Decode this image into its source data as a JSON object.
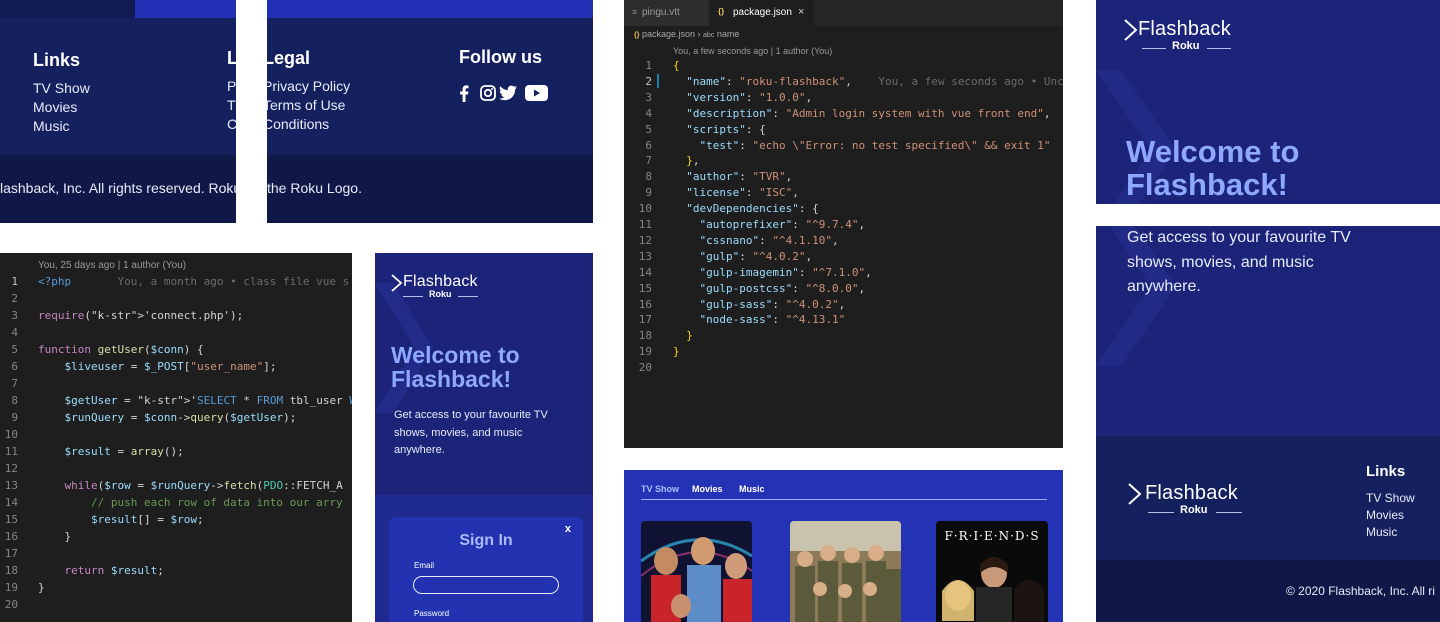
{
  "footer_panel": {
    "links_heading": "Links",
    "links": [
      "TV Show",
      "Movies",
      "Music"
    ],
    "legal_heading_clipped": "L",
    "legal_heading": "Legal",
    "legal_first_letters": [
      "P",
      "T",
      "C"
    ],
    "legal_links": [
      "Privacy Policy",
      "Terms of Use",
      "Conditions"
    ],
    "follow_heading": "Follow us",
    "copyright_left": "lashback, Inc. All rights reserved. Roku,",
    "copyright_right": "the Roku Logo."
  },
  "json_editor": {
    "tabs": [
      {
        "label": "pingu.vtt",
        "icon": "file-lines-icon"
      },
      {
        "label": "package.json",
        "icon": "braces-icon",
        "active": true
      }
    ],
    "breadcrumb": [
      "package.json",
      "name"
    ],
    "blame": "You, a few seconds ago | 1 author (You)",
    "inline_blame": "You, a few seconds ago • Unc",
    "lines": [
      "{",
      "  \"name\": \"roku-flashback\",",
      "  \"version\": \"1.0.0\",",
      "  \"description\": \"Admin login system with vue front end\",",
      "  \"scripts\": {",
      "    \"test\": \"echo \\\"Error: no test specified\\\" && exit 1\"",
      "  },",
      "  \"author\": \"TVR\",",
      "  \"license\": \"ISC\",",
      "  \"devDependencies\": {",
      "    \"autoprefixer\": \"^9.7.4\",",
      "    \"cssnano\": \"^4.1.10\",",
      "    \"gulp\": \"^4.0.2\",",
      "    \"gulp-imagemin\": \"^7.1.0\",",
      "    \"gulp-postcss\": \"^8.0.0\",",
      "    \"gulp-sass\": \"^4.0.2\",",
      "    \"node-sass\": \"^4.13.1\"",
      "  }",
      "}",
      ""
    ]
  },
  "php_editor": {
    "blame": "You, 25 days ago | 1 author (You)",
    "inline_blame": "You, a month ago • class file vue s",
    "lines": [
      "<?php",
      "",
      "require('connect.php');",
      "",
      "function getUser($conn) {",
      "    $liveuser = $_POST[\"user_name\"];",
      "",
      "    $getUser = 'SELECT * FROM tbl_user WHERE u",
      "    $runQuery = $conn->query($getUser);",
      "",
      "    $result = array();",
      "",
      "    while($row = $runQuery->fetch(PDO::FETCH_A",
      "        // push each row of data into our arry",
      "        $result[] = $row;",
      "    }",
      "",
      "    return $result;",
      "}",
      ""
    ]
  },
  "brand": {
    "name": "Flashback",
    "sub": "Roku"
  },
  "hero": {
    "welcome_line1": "Welcome to",
    "welcome_line2": "Flashback!",
    "subtext_lines": [
      "Get access to your favourite TV",
      "shows, movies, and music",
      "anywhere."
    ]
  },
  "signin": {
    "title": "Sign In",
    "close": "x",
    "email_label": "Email",
    "password_label": "Password"
  },
  "tabs_panel": {
    "tabs": [
      "TV Show",
      "Movies",
      "Music"
    ],
    "active_tab": "TV Show",
    "posters": [
      {
        "label": "Star Trek cast"
      },
      {
        "label": "M*A*S*H cast"
      },
      {
        "label": "F·R·I·E·N·D·S",
        "title": "F·R·I·E·N·D·S"
      }
    ]
  },
  "right_footer": {
    "links_heading": "Links",
    "links": [
      "TV Show",
      "Movies",
      "Music"
    ],
    "copyright": "© 2020 Flashback, Inc. All ri"
  },
  "colors": {
    "navy": "#15205f",
    "accent_blue": "#2230b5",
    "welcome_text": "#8fa8ff",
    "editor_bg": "#1e1e1e"
  }
}
